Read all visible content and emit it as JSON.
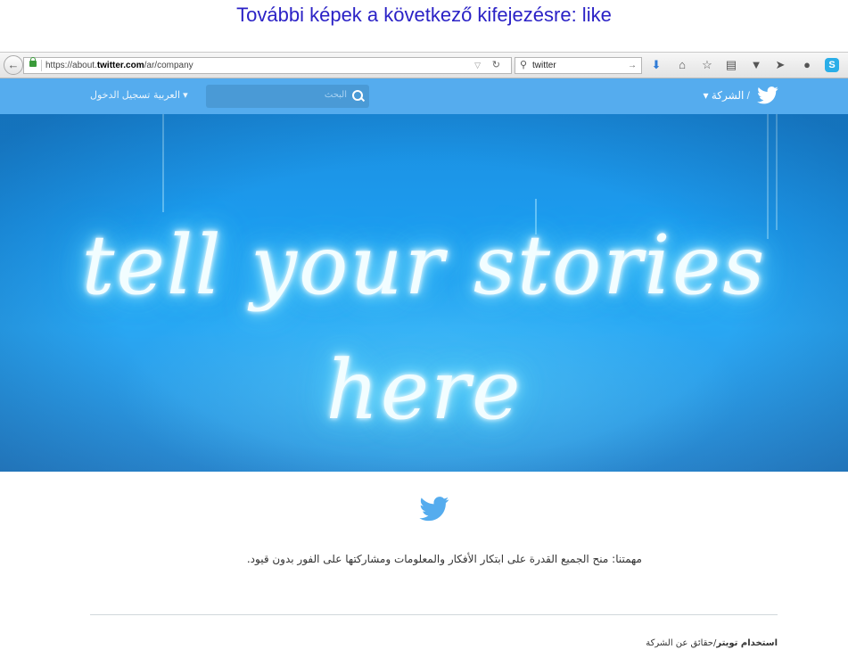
{
  "outer": {
    "heading": "További képek a következő kifejezésre: like"
  },
  "browser": {
    "url_prefix": "https://about.",
    "url_domain": "twitter.com",
    "url_path": "/ar/company",
    "search_value": "twitter",
    "icons": [
      "back-arrow-icon",
      "lock-icon",
      "dropdown-icon",
      "reload-icon",
      "search-icon",
      "go-arrow-icon",
      "download-icon",
      "home-icon",
      "bookmark-star-icon",
      "reading-list-icon",
      "pocket-icon",
      "send-icon",
      "chat-icon",
      "skype-icon"
    ]
  },
  "twitter_nav": {
    "company_label": "الشركة",
    "search_placeholder": "البحث",
    "language_label": "العربية",
    "login_label": "تسجيل الدخول",
    "bar_color": "#55acee"
  },
  "hero": {
    "neon_text": "tell your stories here",
    "neon_color": "#f2fdff"
  },
  "content": {
    "mission": "مهمتنا: منح الجميع القدرة على ابتكار الأفكار والمعلومات ومشاركتها على الفور بدون قيود.",
    "footer_bold": "استخدام تويتر",
    "footer_sep": "/",
    "footer_rest": "حقائق عن الشركة"
  }
}
